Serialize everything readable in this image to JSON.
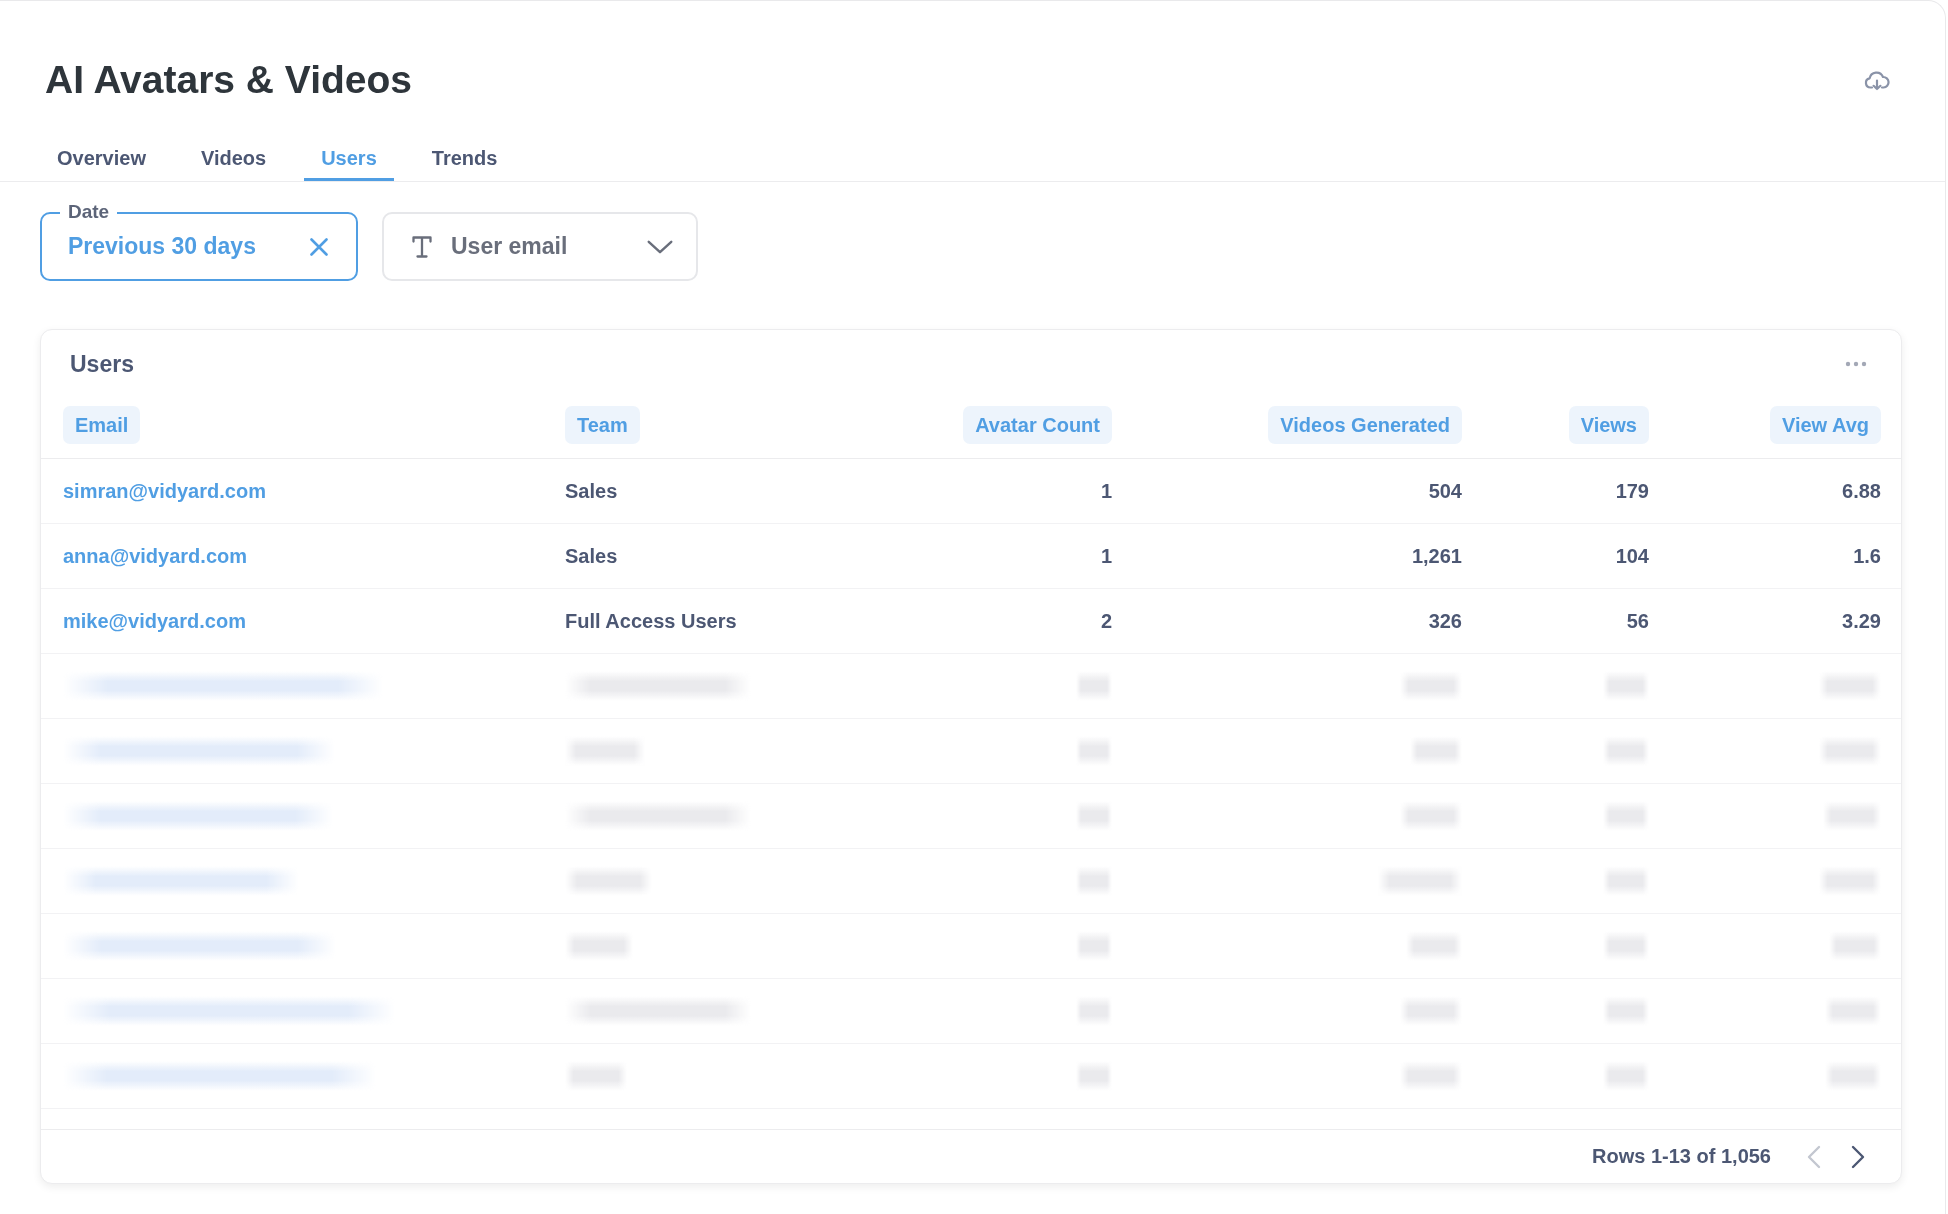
{
  "header": {
    "title": "AI Avatars & Videos"
  },
  "tabs": [
    {
      "label": "Overview",
      "selected": false
    },
    {
      "label": "Videos",
      "selected": false
    },
    {
      "label": "Users",
      "selected": true
    },
    {
      "label": "Trends",
      "selected": false
    }
  ],
  "filters": [
    {
      "kind": "date",
      "label": "Date",
      "value": "Previous 30 days"
    },
    {
      "kind": "text",
      "placeholder": "User email"
    }
  ],
  "users_card": {
    "title": "Users",
    "columns": [
      {
        "label": "Email",
        "kind": "link"
      },
      {
        "label": "Team",
        "kind": "text"
      },
      {
        "label": "Avatar Count",
        "kind": "number"
      },
      {
        "label": "Videos Generated",
        "kind": "number"
      },
      {
        "label": "Views",
        "kind": "number"
      },
      {
        "label": "View Avg",
        "kind": "number"
      }
    ],
    "rows": [
      {
        "kind": "data",
        "cells": [
          "simran@vidyard.com",
          "Sales",
          "1",
          "504",
          "179",
          "6.88"
        ]
      },
      {
        "kind": "data",
        "cells": [
          "anna@vidyard.com",
          "Sales",
          "1",
          "1,261",
          "104",
          "1.6"
        ]
      },
      {
        "kind": "data",
        "cells": [
          "mike@vidyard.com",
          "Full Access Users",
          "2",
          "326",
          "56",
          "3.29"
        ]
      },
      {
        "kind": "blurred"
      },
      {
        "kind": "blurred"
      },
      {
        "kind": "blurred"
      },
      {
        "kind": "blurred"
      },
      {
        "kind": "blurred"
      },
      {
        "kind": "blurred"
      },
      {
        "kind": "blurred"
      }
    ],
    "pagination": {
      "label": "Rows 1-13 of 1,056",
      "previous": {
        "disabled": true
      },
      "next": {
        "disabled": false
      }
    }
  }
}
